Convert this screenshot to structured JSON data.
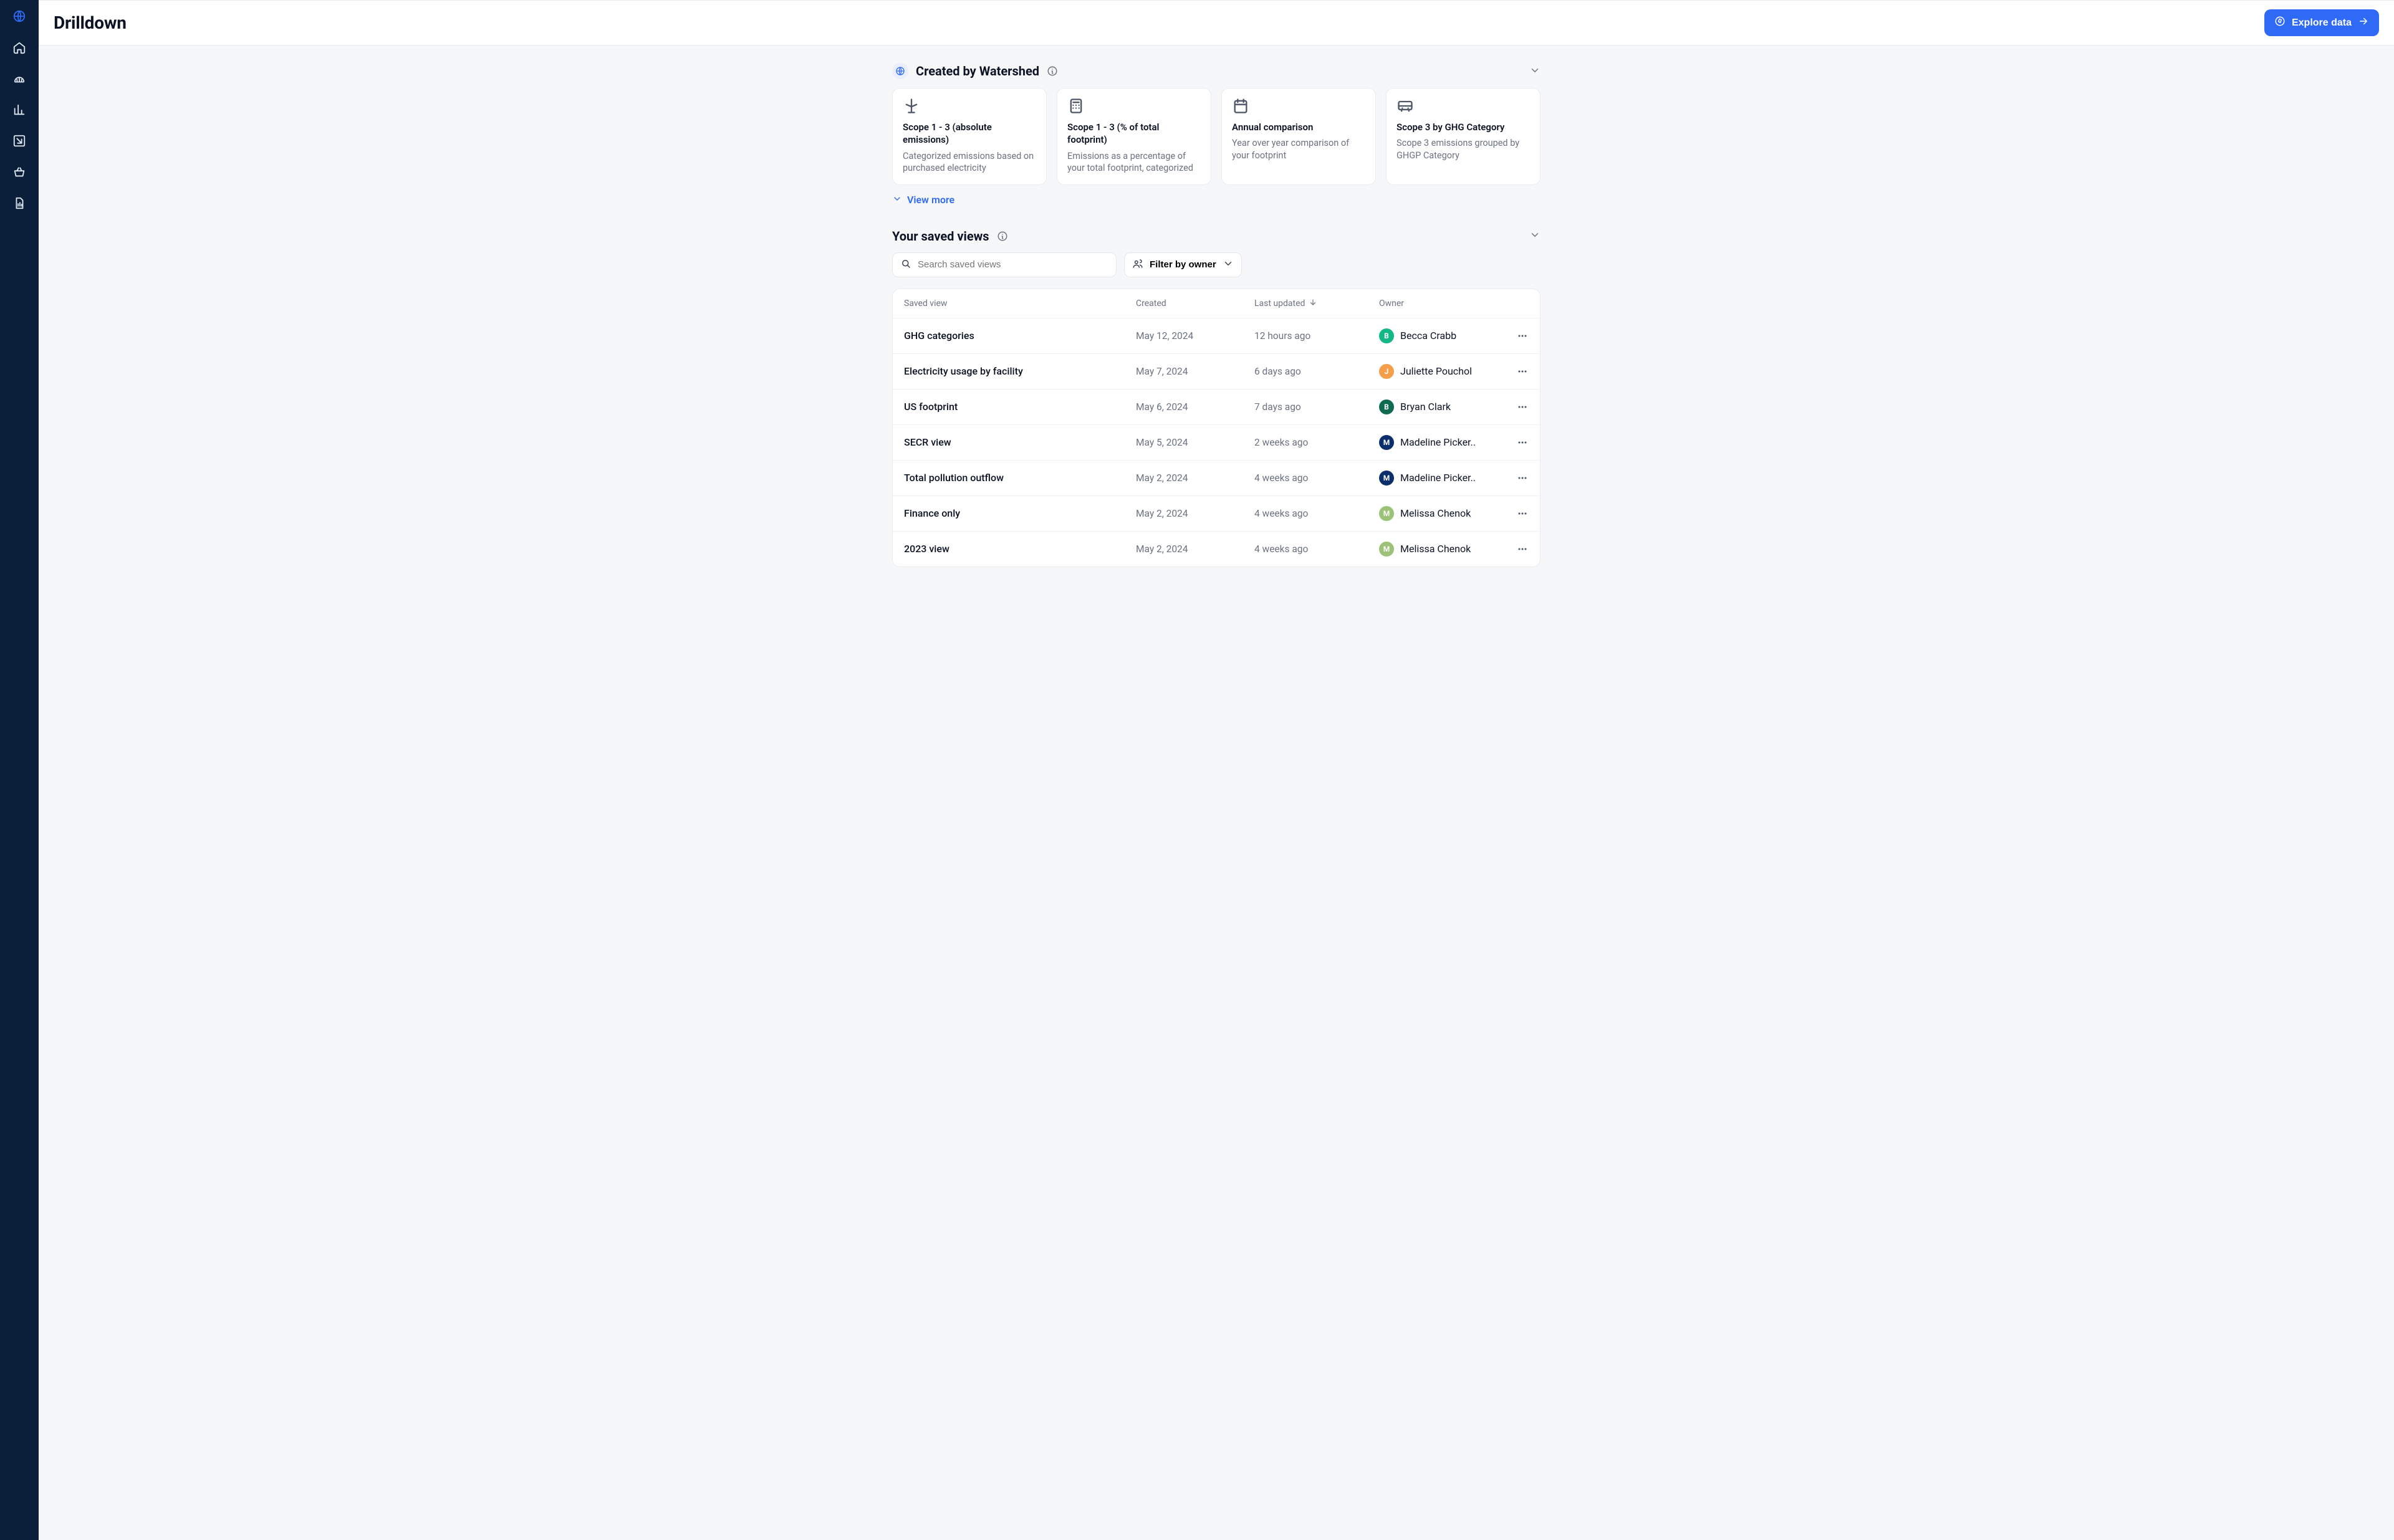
{
  "header": {
    "title": "Drilldown",
    "explore_label": "Explore data"
  },
  "section_watershed": {
    "title": "Created by Watershed",
    "view_more_label": "View more",
    "cards": [
      {
        "icon": "windmill-icon",
        "title": "Scope 1 - 3 (absolute emissions)",
        "desc": "Categorized emissions based on purchased electricity"
      },
      {
        "icon": "calculator-icon",
        "title": "Scope 1 - 3 (% of total footprint)",
        "desc": "Emissions as a percentage of your total footprint, categorized by GHG…"
      },
      {
        "icon": "calendar-icon",
        "title": "Annual comparison",
        "desc": "Year over year comparison of your footprint"
      },
      {
        "icon": "bus-icon",
        "title": "Scope 3 by GHG Category",
        "desc": "Scope 3 emissions grouped by GHGP Category"
      }
    ]
  },
  "section_saved": {
    "title": "Your saved views",
    "search_placeholder": "Search saved views",
    "filter_label": "Filter by owner",
    "columns": {
      "name": "Saved view",
      "created": "Created",
      "updated": "Last updated",
      "owner": "Owner"
    },
    "rows": [
      {
        "name": "GHG categories",
        "created": "May 12, 2024",
        "updated": "12 hours ago",
        "owner": {
          "initial": "B",
          "name": "Becca Crabb",
          "color": "#12b886"
        }
      },
      {
        "name": "Electricity usage by facility",
        "created": "May 7, 2024",
        "updated": "6 days ago",
        "owner": {
          "initial": "J",
          "name": "Juliette Pouchol",
          "color": "#f59f4b"
        }
      },
      {
        "name": "US footprint",
        "created": "May 6, 2024",
        "updated": "7 days ago",
        "owner": {
          "initial": "B",
          "name": "Bryan Clark",
          "color": "#0f6b4f"
        }
      },
      {
        "name": "SECR view",
        "created": "May 5, 2024",
        "updated": "2 weeks ago",
        "owner": {
          "initial": "M",
          "name": "Madeline Picker..",
          "color": "#0b2f6b"
        }
      },
      {
        "name": "Total pollution outflow",
        "created": "May 2, 2024",
        "updated": "4 weeks ago",
        "owner": {
          "initial": "M",
          "name": "Madeline Picker..",
          "color": "#0b2f6b"
        }
      },
      {
        "name": "Finance only",
        "created": "May 2, 2024",
        "updated": "4 weeks ago",
        "owner": {
          "initial": "M",
          "name": "Melissa Chenok",
          "color": "#9cc279"
        }
      },
      {
        "name": "2023 view",
        "created": "May 2, 2024",
        "updated": "4 weeks ago",
        "owner": {
          "initial": "M",
          "name": "Melissa Chenok",
          "color": "#9cc279"
        }
      }
    ]
  }
}
